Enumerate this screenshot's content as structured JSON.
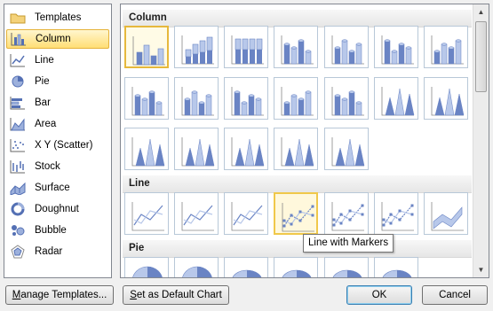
{
  "categories": [
    {
      "label": "Templates",
      "icon": "folder-icon"
    },
    {
      "label": "Column",
      "icon": "column-chart-icon",
      "selected": true
    },
    {
      "label": "Line",
      "icon": "line-chart-icon"
    },
    {
      "label": "Pie",
      "icon": "pie-chart-icon"
    },
    {
      "label": "Bar",
      "icon": "bar-chart-icon"
    },
    {
      "label": "Area",
      "icon": "area-chart-icon"
    },
    {
      "label": "X Y (Scatter)",
      "icon": "scatter-chart-icon"
    },
    {
      "label": "Stock",
      "icon": "stock-chart-icon"
    },
    {
      "label": "Surface",
      "icon": "surface-chart-icon"
    },
    {
      "label": "Doughnut",
      "icon": "doughnut-chart-icon"
    },
    {
      "label": "Bubble",
      "icon": "bubble-chart-icon"
    },
    {
      "label": "Radar",
      "icon": "radar-chart-icon"
    }
  ],
  "sections": [
    {
      "title": "Column",
      "thumb_count": 19
    },
    {
      "title": "Line",
      "thumb_count": 7
    },
    {
      "title": "Pie",
      "thumb_count": 6
    }
  ],
  "tooltip": "Line with Markers",
  "buttons": {
    "manage_templates": {
      "prefix": "",
      "accel": "M",
      "rest": "anage Templates..."
    },
    "set_default": {
      "prefix": "",
      "accel": "S",
      "rest": "et as Default Chart"
    },
    "ok": "OK",
    "cancel": "Cancel"
  },
  "colors": {
    "selection_fill": "#ffde75",
    "selection_border": "#e5b33a",
    "chart_blue": "#6a84c4",
    "chart_blue_light": "#b8c8ea"
  }
}
